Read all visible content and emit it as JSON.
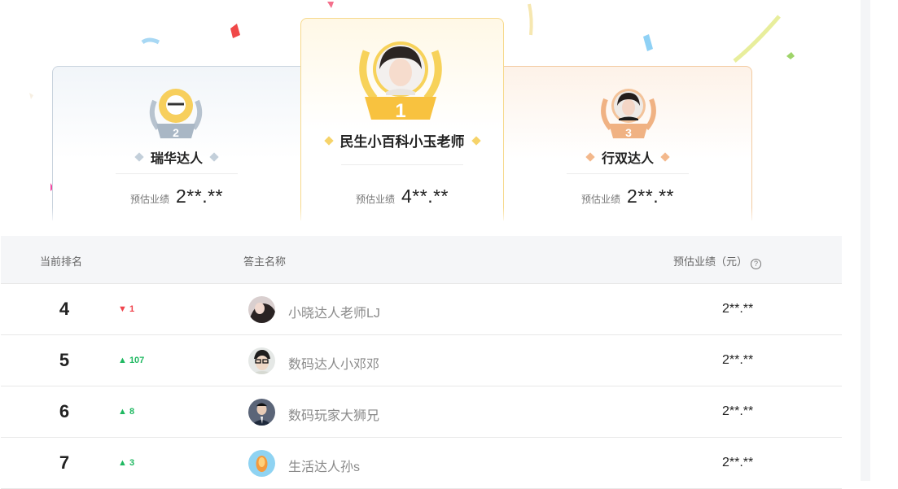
{
  "podium": [
    {
      "place": "1",
      "name": "民生小百科小玉老师",
      "perf_label": "预估业绩",
      "perf_value": "4**.**",
      "color": "#f7c844"
    },
    {
      "place": "2",
      "name": "瑞华达人",
      "perf_label": "预估业绩",
      "perf_value": "2**.**",
      "color": "#b7c3cf"
    },
    {
      "place": "3",
      "name": "行双达人",
      "perf_label": "预估业绩",
      "perf_value": "2**.**",
      "color": "#f0b283"
    }
  ],
  "table": {
    "headers": {
      "rank": "当前排名",
      "name": "答主名称",
      "perf": "预估业绩（元）"
    },
    "rows": [
      {
        "rank": "4",
        "trend": "▼ 1",
        "direction": "down",
        "name": "小晓达人老师LJ",
        "score": "2**.**"
      },
      {
        "rank": "5",
        "trend": "▲ 107",
        "direction": "up",
        "name": "数码达人小邓邓",
        "score": "2**.**"
      },
      {
        "rank": "6",
        "trend": "▲ 8",
        "direction": "up",
        "name": "数码玩家大狮兄",
        "score": "2**.**"
      },
      {
        "rank": "7",
        "trend": "▲ 3",
        "direction": "up",
        "name": "生活达人孙s",
        "score": "2**.**"
      }
    ]
  },
  "colors": {
    "up": "#1fb861",
    "down": "#f0434c",
    "gold": "#f7c844",
    "silver": "#b7c3cf",
    "bronze": "#f0b283"
  },
  "icons": {
    "help": "question-circle-icon",
    "rank_up": "triangle-up-icon",
    "rank_down": "triangle-down-icon"
  }
}
